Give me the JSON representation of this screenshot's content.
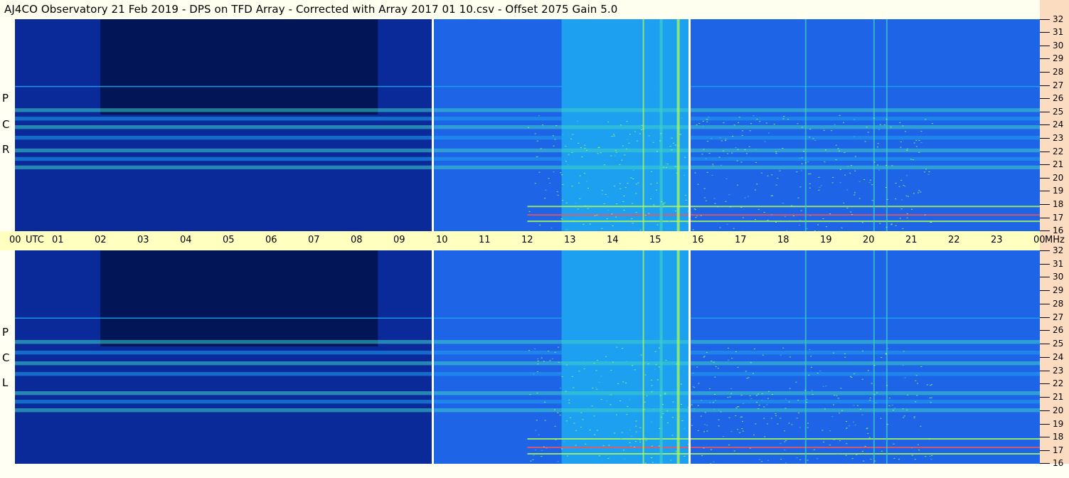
{
  "title": "AJ4CO Observatory  21 Feb 2019  -  DPS on TFD Array  -  Corrected with Array 2017 01 10.csv  -  Offset 2075  Gain 5.0",
  "panels": [
    {
      "name": "rcp",
      "letters": [
        "R",
        "C",
        "P"
      ]
    },
    {
      "name": "lcp",
      "letters": [
        "L",
        "C",
        "P"
      ]
    }
  ],
  "time_labels": [
    "00",
    "UTC",
    "01",
    "02",
    "03",
    "04",
    "05",
    "06",
    "07",
    "08",
    "09",
    "10",
    "11",
    "12",
    "13",
    "14",
    "15",
    "16",
    "17",
    "18",
    "19",
    "20",
    "21",
    "22",
    "23",
    "00",
    "MHz"
  ],
  "colors": {
    "background": "#fffff0",
    "timebar": "#ffffc0",
    "freq_axis": "#fcdcc0",
    "separator": "#ffffff"
  },
  "chart_data": {
    "type": "heatmap",
    "title": "AJ4CO Observatory  21 Feb 2019  -  DPS on TFD Array  -  Corrected with Array 2017 01 10.csv  -  Offset 2075  Gain 5.0",
    "x": {
      "label": "UTC",
      "range_hours": [
        0,
        24
      ],
      "ticks": [
        "00",
        "01",
        "02",
        "03",
        "04",
        "05",
        "06",
        "07",
        "08",
        "09",
        "10",
        "11",
        "12",
        "13",
        "14",
        "15",
        "16",
        "17",
        "18",
        "19",
        "20",
        "21",
        "22",
        "23",
        "00"
      ]
    },
    "y": {
      "label": "MHz",
      "range": [
        16,
        32
      ],
      "ticks": [
        16,
        17,
        18,
        19,
        20,
        21,
        22,
        23,
        24,
        25,
        26,
        27,
        28,
        29,
        30,
        31,
        32
      ]
    },
    "polarizations": [
      "RCP",
      "LCP"
    ],
    "data_gaps_utc": [
      9.8,
      15.8
    ],
    "colormap": [
      "#001040",
      "#0a2a9a",
      "#1e64e6",
      "#1ea0f0",
      "#3cd0c8",
      "#b4ff50",
      "#ff5050",
      "#ffffff"
    ]
  }
}
